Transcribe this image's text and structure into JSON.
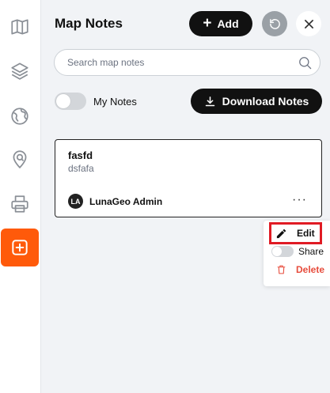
{
  "rail": {
    "items": [
      {
        "icon": "map-icon",
        "active": false
      },
      {
        "icon": "layers-icon",
        "active": false
      },
      {
        "icon": "globe-icon",
        "active": false
      },
      {
        "icon": "location-search-icon",
        "active": false
      },
      {
        "icon": "printer-icon",
        "active": false
      },
      {
        "icon": "add-note-icon",
        "active": true
      }
    ],
    "accent_color": "#ff5a0a"
  },
  "header": {
    "title": "Map Notes",
    "add_label": "Add",
    "reset_icon": "refresh-icon",
    "close_icon": "close-icon"
  },
  "search": {
    "placeholder": "Search map notes",
    "value": ""
  },
  "filters": {
    "my_notes_label": "My Notes",
    "my_notes_enabled": false,
    "download_label": "Download Notes"
  },
  "notes": [
    {
      "title": "fasfd",
      "description": "dsfafa",
      "author_initials": "LA",
      "author_name": "LunaGeo Admin",
      "more_label": "···"
    }
  ],
  "context_menu": {
    "edit_label": "Edit",
    "share_label": "Share",
    "share_enabled": false,
    "delete_label": "Delete",
    "delete_color": "#e74c3c",
    "highlight_color": "#e01b24"
  }
}
